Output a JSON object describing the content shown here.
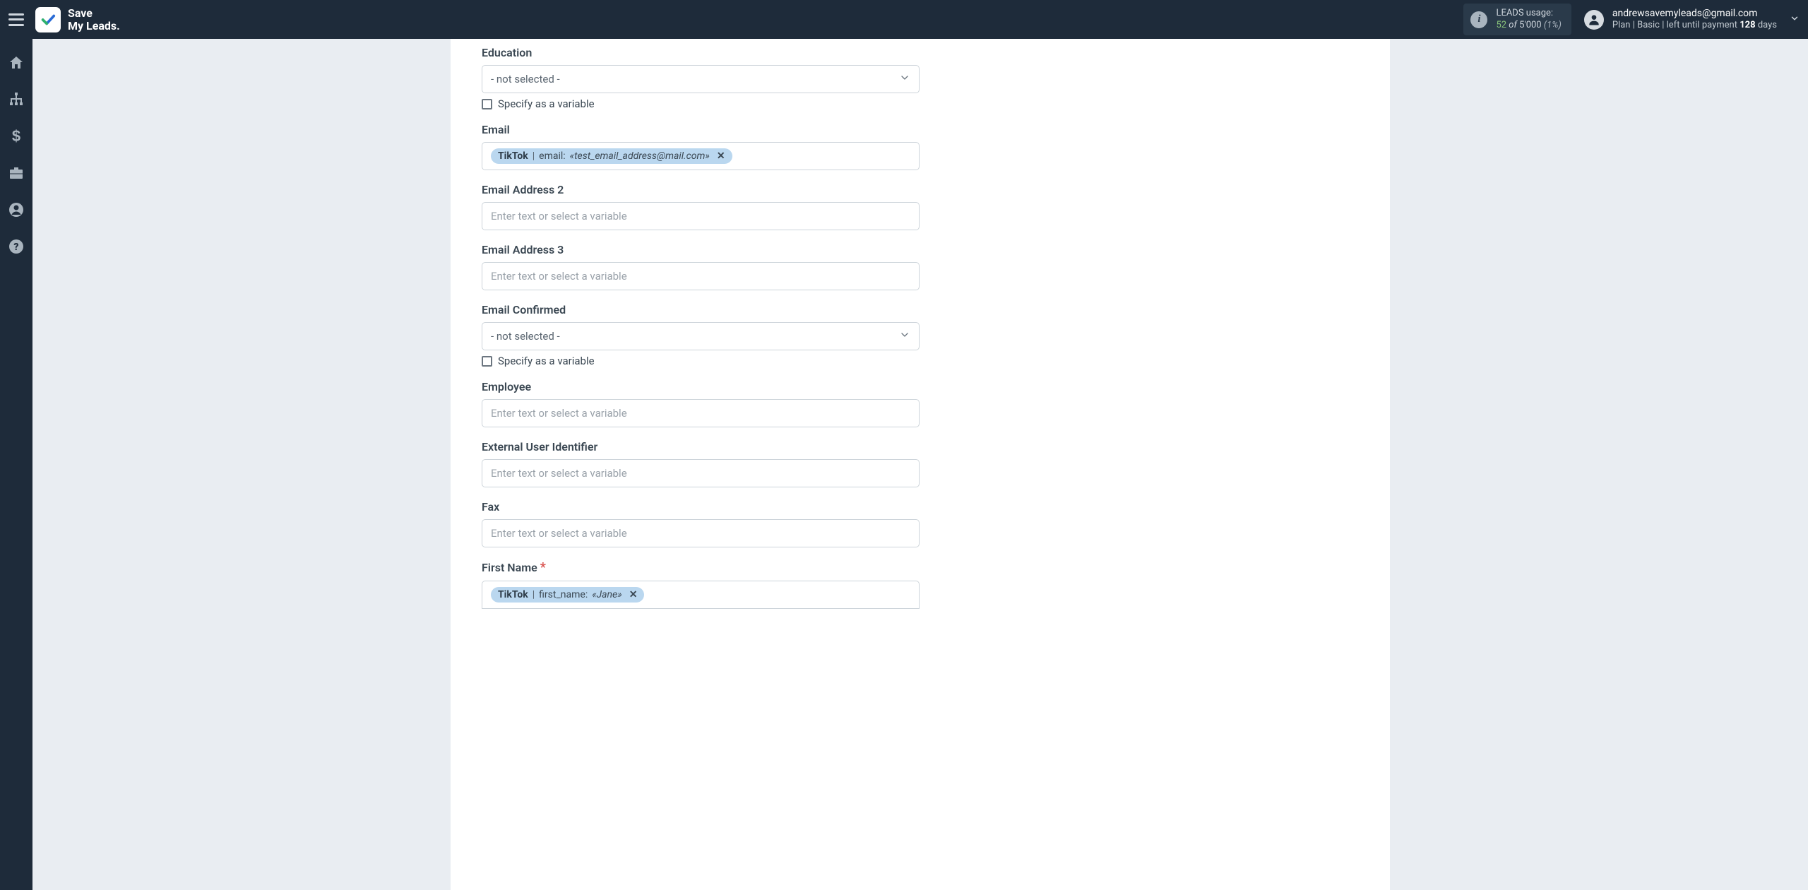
{
  "header": {
    "logo_line1": "Save",
    "logo_line2": "My Leads.",
    "usage_label": "LEADS usage:",
    "usage_current": "52",
    "usage_of": "of",
    "usage_total": "5'000",
    "usage_pct": "(1%)",
    "account_email": "andrewsavemyleads@gmail.com",
    "plan_prefix": "Plan |",
    "plan_name": "Basic",
    "plan_suffix": "| left until payment",
    "plan_days": "128",
    "plan_days_word": "days"
  },
  "form": {
    "not_selected": "- not selected -",
    "placeholder": "Enter text or select a variable",
    "specify_variable": "Specify as a variable",
    "fields": {
      "education": {
        "label": "Education"
      },
      "email": {
        "label": "Email",
        "tag_source": "TikTok",
        "tag_field": "email:",
        "tag_value": "«test_email_address@mail.com»"
      },
      "email2": {
        "label": "Email Address 2"
      },
      "email3": {
        "label": "Email Address 3"
      },
      "email_confirmed": {
        "label": "Email Confirmed"
      },
      "employee": {
        "label": "Employee"
      },
      "external_user_id": {
        "label": "External User Identifier"
      },
      "fax": {
        "label": "Fax"
      },
      "first_name": {
        "label": "First Name",
        "tag_source": "TikTok",
        "tag_field": "first_name:",
        "tag_value": "«Jane»"
      }
    }
  }
}
